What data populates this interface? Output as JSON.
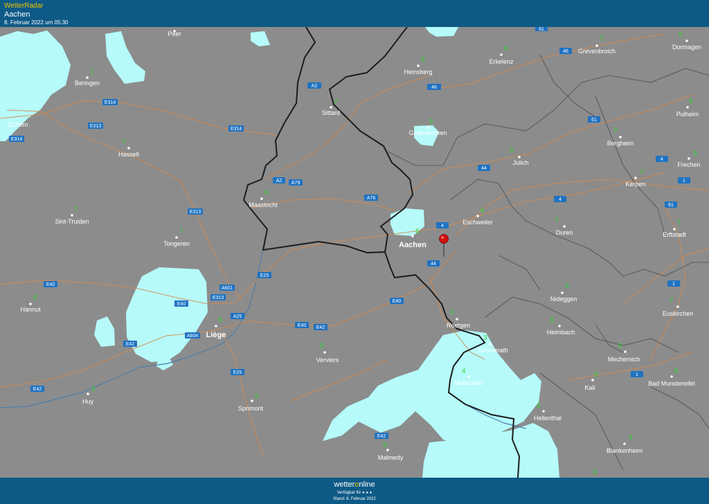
{
  "header": {
    "brand": "WetterRadar",
    "location": "Aachen",
    "datetime": "8. Februar 2022 um 05:30"
  },
  "footer": {
    "logo_part1": "wetter",
    "logo_o": "o",
    "logo_part2": "nline",
    "availability": "Verfügbar für",
    "stand": "Stand: 8. Februar 2022"
  },
  "cities": [
    {
      "id": "peer",
      "name": "Peer",
      "temp": ""
    },
    {
      "id": "beringen",
      "name": "Beringen",
      "temp": "7"
    },
    {
      "id": "zichem",
      "name": "-Zichem",
      "temp": ""
    },
    {
      "id": "hasselt",
      "name": "Hasselt",
      "temp": "7"
    },
    {
      "id": "sint-truiden",
      "name": "Sint-Truiden",
      "temp": "7"
    },
    {
      "id": "tongeren",
      "name": "Tongeren",
      "temp": "7"
    },
    {
      "id": "hannut",
      "name": "Hannut",
      "temp": "6"
    },
    {
      "id": "huy",
      "name": "Huy",
      "temp": "6"
    },
    {
      "id": "liege",
      "name": "Liège",
      "temp": "6",
      "big": true
    },
    {
      "id": "sprimont",
      "name": "Sprimont",
      "temp": "5"
    },
    {
      "id": "verviers",
      "name": "Verviers",
      "temp": "5"
    },
    {
      "id": "malmedy",
      "name": "Malmedy",
      "temp": "5"
    },
    {
      "id": "maastricht",
      "name": "Maastricht",
      "temp": "6"
    },
    {
      "id": "sittard",
      "name": "Sittard",
      "temp": "7"
    },
    {
      "id": "heinsberg",
      "name": "Heinsberg",
      "temp": "6"
    },
    {
      "id": "geilenkirchen",
      "name": "Geilenkirchen",
      "temp": "6"
    },
    {
      "id": "erkelenz",
      "name": "Erkelenz",
      "temp": "6"
    },
    {
      "id": "aachen",
      "name": "Aachen",
      "temp": "6",
      "big": true
    },
    {
      "id": "eschweiler",
      "name": "Eschweiler",
      "temp": "6"
    },
    {
      "id": "julich",
      "name": "Julich",
      "temp": "6"
    },
    {
      "id": "duren",
      "name": "Duren",
      "temp": "7"
    },
    {
      "id": "roetgen",
      "name": "Roetgen",
      "temp": "3"
    },
    {
      "id": "simmerath",
      "name": "Simmerath",
      "temp": "3"
    },
    {
      "id": "monschau",
      "name": "Monschau",
      "temp": "4"
    },
    {
      "id": "nideggen",
      "name": "Nideggen",
      "temp": "6"
    },
    {
      "id": "heimbach",
      "name": "Heimbach",
      "temp": "6"
    },
    {
      "id": "hellenthal",
      "name": "Hellenthal",
      "temp": "4"
    },
    {
      "id": "blankenheim",
      "name": "Blankenheim",
      "temp": "4"
    },
    {
      "id": "kall",
      "name": "Kall",
      "temp": "5"
    },
    {
      "id": "mechernich",
      "name": "Mechernich",
      "temp": "5"
    },
    {
      "id": "bad-munstereifel",
      "name": "Bad Munstereifel",
      "temp": "5"
    },
    {
      "id": "euskirchen",
      "name": "Euskirchen",
      "temp": "7"
    },
    {
      "id": "erftstadt",
      "name": "Erftstadt",
      "temp": "7"
    },
    {
      "id": "kerpen",
      "name": "Kerpen",
      "temp": "7"
    },
    {
      "id": "frechen",
      "name": "Frechen",
      "temp": "6"
    },
    {
      "id": "bergheim",
      "name": "Bergheim",
      "temp": "7"
    },
    {
      "id": "pulheim",
      "name": "Pulheim",
      "temp": "6"
    },
    {
      "id": "grevenbroich",
      "name": "Grevenbroich",
      "temp": "7"
    },
    {
      "id": "dormagen",
      "name": "Dormagen",
      "temp": "6"
    },
    {
      "id": "extra-temp-1",
      "name": "",
      "temp": "3"
    }
  ],
  "roads": [
    {
      "id": "a2-north",
      "label": "A2"
    },
    {
      "id": "a2-south",
      "label": "A2"
    },
    {
      "id": "a79",
      "label": "A79"
    },
    {
      "id": "a76",
      "label": "A76"
    },
    {
      "id": "r46-a",
      "label": "46"
    },
    {
      "id": "r46-b",
      "label": "46"
    },
    {
      "id": "r61-top",
      "label": "61"
    },
    {
      "id": "r61-a",
      "label": "61"
    },
    {
      "id": "r61-b",
      "label": "61"
    },
    {
      "id": "r44-a",
      "label": "44"
    },
    {
      "id": "r44-b",
      "label": "44"
    },
    {
      "id": "r4-a",
      "label": "4"
    },
    {
      "id": "r4-b",
      "label": "4"
    },
    {
      "id": "r4-c",
      "label": "4"
    },
    {
      "id": "r1-a",
      "label": "1"
    },
    {
      "id": "r1-b",
      "label": "1"
    },
    {
      "id": "r1-c",
      "label": "1"
    },
    {
      "id": "e314-a",
      "label": "E314"
    },
    {
      "id": "e314-b",
      "label": "E314"
    },
    {
      "id": "e314-c",
      "label": "E314"
    },
    {
      "id": "e313-a",
      "label": "E313"
    },
    {
      "id": "e313-b",
      "label": "E313"
    },
    {
      "id": "e313-c",
      "label": "E313"
    },
    {
      "id": "e40-a",
      "label": "E40"
    },
    {
      "id": "e40-b",
      "label": "E40"
    },
    {
      "id": "e40-c",
      "label": "E40"
    },
    {
      "id": "e40-d",
      "label": "E40"
    },
    {
      "id": "e42-a",
      "label": "E42"
    },
    {
      "id": "e42-b",
      "label": "E42"
    },
    {
      "id": "e42-c",
      "label": "E42"
    },
    {
      "id": "e42-d",
      "label": "E42"
    },
    {
      "id": "e25-a",
      "label": "E25"
    },
    {
      "id": "e25-b",
      "label": "E25"
    },
    {
      "id": "a601",
      "label": "A601"
    },
    {
      "id": "a25",
      "label": "A25"
    },
    {
      "id": "a604",
      "label": "A604"
    }
  ],
  "colors": {
    "header_bg": "#0e5a86",
    "map_bg": "#8c8c8c",
    "precip": "#b6fafa",
    "border": "#1c1c1c",
    "admin": "#5c5c5c",
    "road": "#d48a4f",
    "river": "#4c7ea8",
    "temp": "#2fd62f",
    "shield": "#1f73c3"
  },
  "marker": {
    "icon": "map-pin-icon",
    "label": "Aachen"
  }
}
